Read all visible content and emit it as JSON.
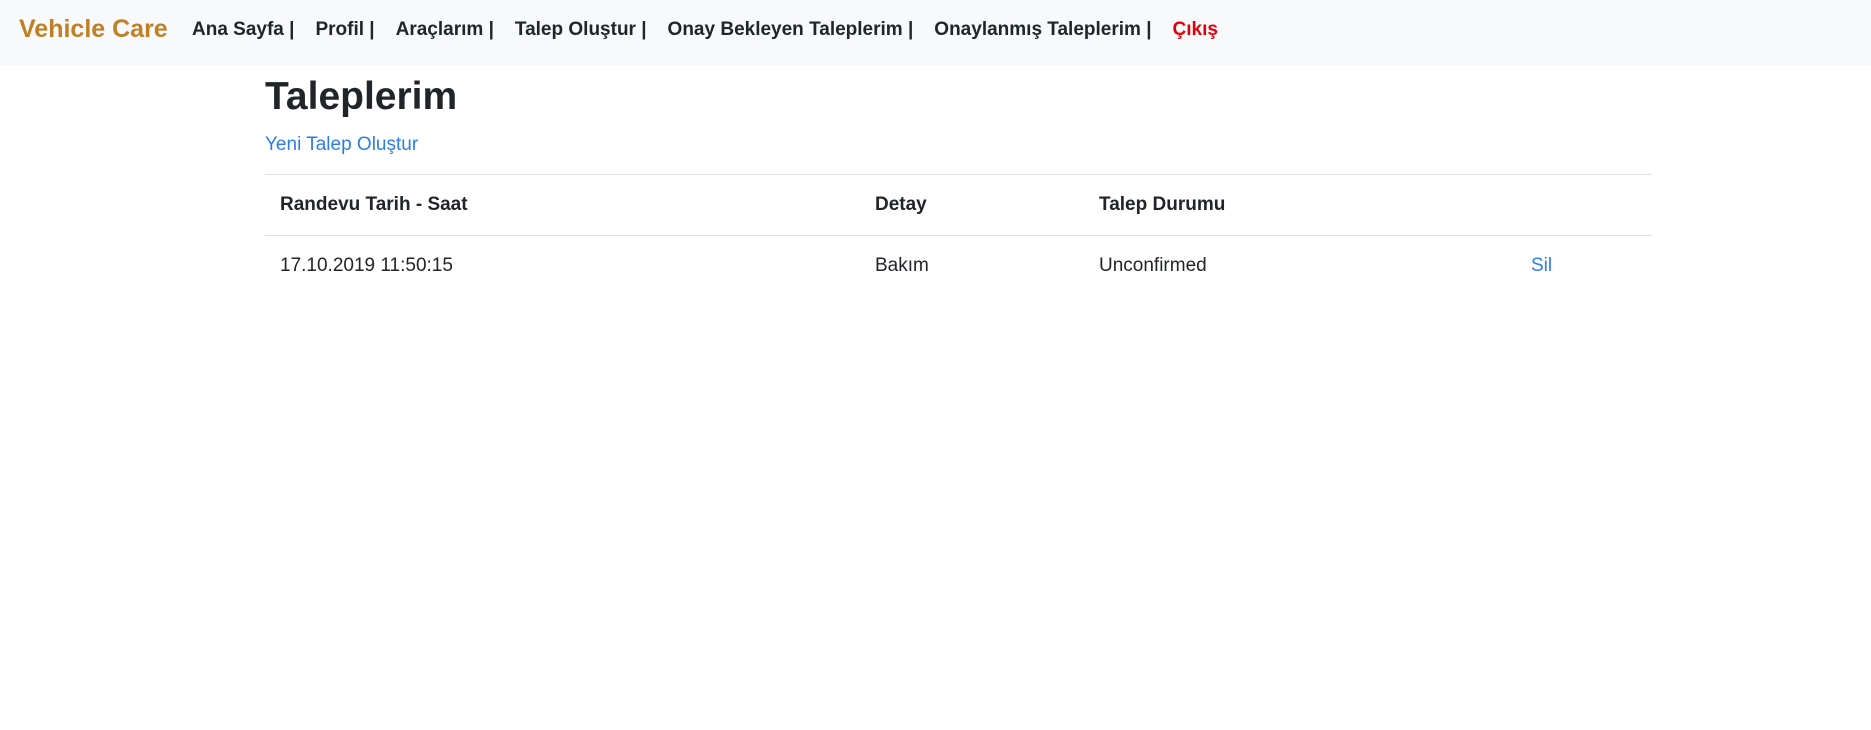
{
  "navbar": {
    "brand": "Vehicle Care",
    "items": [
      {
        "label": "Ana Sayfa |"
      },
      {
        "label": "Profil |"
      },
      {
        "label": "Araçlarım |"
      },
      {
        "label": "Talep Oluştur |"
      },
      {
        "label": "Onay Bekleyen Taleplerim |"
      },
      {
        "label": "Onaylanmış Taleplerim |"
      },
      {
        "label": "Çıkış"
      }
    ]
  },
  "main": {
    "title": "Taleplerim",
    "new_request_link": "Yeni Talep Oluştur",
    "table": {
      "headers": [
        "Randevu Tarih - Saat",
        "Detay",
        "Talep Durumu",
        ""
      ],
      "rows": [
        {
          "date": "17.10.2019 11:50:15",
          "detail": "Bakım",
          "status": "Unconfirmed",
          "action": "Sil"
        }
      ]
    }
  },
  "colors": {
    "brand": "#c17f24",
    "link": "#2b7de9",
    "logout": "#e3000b",
    "navbar_bg": "#f8f9fa"
  }
}
